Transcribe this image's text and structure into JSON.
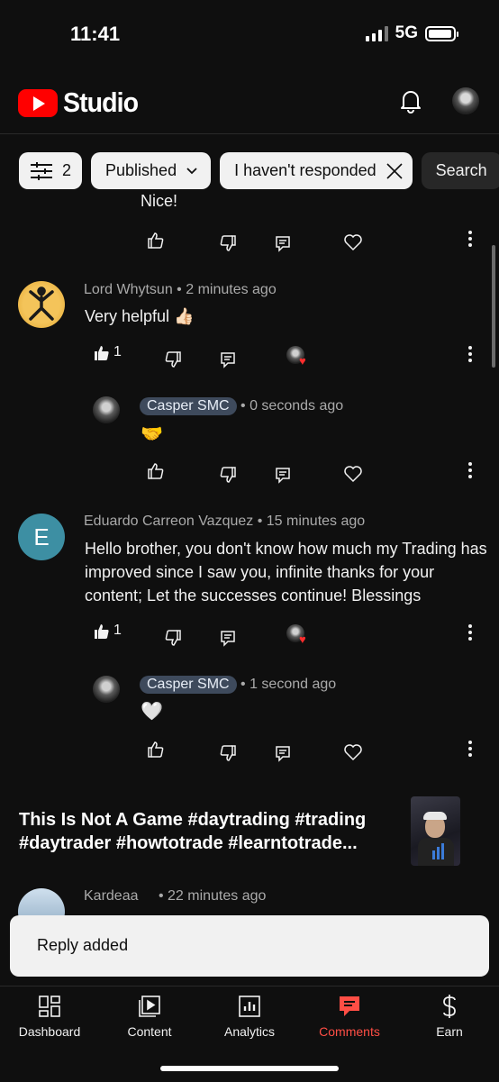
{
  "status_bar": {
    "time": "11:41",
    "network": "5G"
  },
  "header": {
    "app_name": "Studio"
  },
  "filters": {
    "count": "2",
    "published": "Published",
    "response": "I haven't responded",
    "search": "Search"
  },
  "comments": [
    {
      "clipped_text": "Nice!"
    },
    {
      "author": "Lord Whytsun",
      "time": "2 minutes ago",
      "text": "Very helpful 👍🏻",
      "likes": "1",
      "reply": {
        "author": "Casper SMC",
        "time": "0 seconds ago",
        "text": "🤝"
      }
    },
    {
      "author": "Eduardo Carreon Vazquez",
      "avatar_letter": "E",
      "time": "15 minutes ago",
      "text": "Hello brother, you don't know how much my Trading has improved since I saw you, infinite thanks for your content; Let the successes continue! Blessings",
      "likes": "1",
      "reply": {
        "author": "Casper SMC",
        "time": "1 second ago",
        "text": "🤍"
      }
    }
  ],
  "video": {
    "title": "This Is Not A Game #daytrading #trading #daytrader #howtotrade #learntotrade..."
  },
  "next_comment": {
    "author": "Kardeaa",
    "time": "22 minutes ago"
  },
  "toast": {
    "message": "Reply added"
  },
  "nav": {
    "items": [
      {
        "label": "Dashboard",
        "icon": "dashboard-icon"
      },
      {
        "label": "Content",
        "icon": "content-icon"
      },
      {
        "label": "Analytics",
        "icon": "analytics-icon"
      },
      {
        "label": "Comments",
        "icon": "comments-icon",
        "active": true
      },
      {
        "label": "Earn",
        "icon": "earn-icon"
      }
    ]
  },
  "colors": {
    "accent": "#ff4e45",
    "youtube_red": "#ff0000",
    "background": "#0f0f0f"
  }
}
